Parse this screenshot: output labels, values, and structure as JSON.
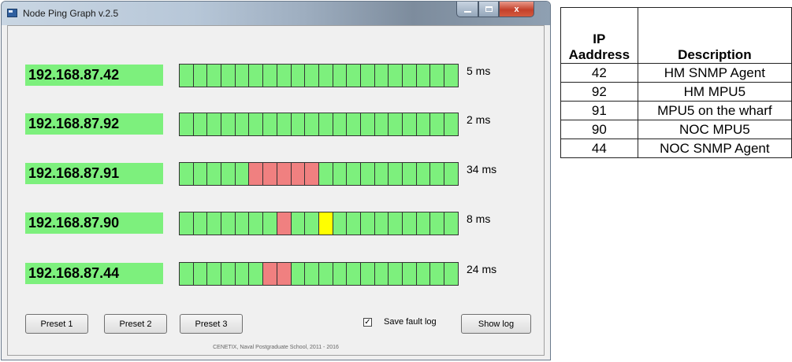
{
  "window": {
    "title": "Node Ping Graph  v.2.5",
    "controls": {
      "close_label": "x"
    }
  },
  "nodes": [
    {
      "ip": "192.168.87.42",
      "latency": "5 ms",
      "cells": [
        "ok",
        "ok",
        "ok",
        "ok",
        "ok",
        "ok",
        "ok",
        "ok",
        "ok",
        "ok",
        "ok",
        "ok",
        "ok",
        "ok",
        "ok",
        "ok",
        "ok",
        "ok",
        "ok",
        "ok"
      ]
    },
    {
      "ip": "192.168.87.92",
      "latency": "2 ms",
      "cells": [
        "ok",
        "ok",
        "ok",
        "ok",
        "ok",
        "ok",
        "ok",
        "ok",
        "ok",
        "ok",
        "ok",
        "ok",
        "ok",
        "ok",
        "ok",
        "ok",
        "ok",
        "ok",
        "ok",
        "ok"
      ]
    },
    {
      "ip": "192.168.87.91",
      "latency": "34 ms",
      "cells": [
        "ok",
        "ok",
        "ok",
        "ok",
        "ok",
        "bad",
        "bad",
        "bad",
        "bad",
        "bad",
        "ok",
        "ok",
        "ok",
        "ok",
        "ok",
        "ok",
        "ok",
        "ok",
        "ok",
        "ok"
      ]
    },
    {
      "ip": "192.168.87.90",
      "latency": "8 ms",
      "cells": [
        "ok",
        "ok",
        "ok",
        "ok",
        "ok",
        "ok",
        "ok",
        "bad",
        "ok",
        "ok",
        "warn",
        "ok",
        "ok",
        "ok",
        "ok",
        "ok",
        "ok",
        "ok",
        "ok",
        "ok"
      ]
    },
    {
      "ip": "192.168.87.44",
      "latency": "24 ms",
      "cells": [
        "ok",
        "ok",
        "ok",
        "ok",
        "ok",
        "ok",
        "bad",
        "bad",
        "ok",
        "ok",
        "ok",
        "ok",
        "ok",
        "ok",
        "ok",
        "ok",
        "ok",
        "ok",
        "ok",
        "ok"
      ]
    }
  ],
  "buttons": {
    "preset1": "Preset 1",
    "preset2": "Preset 2",
    "preset3": "Preset 3",
    "show_log": "Show log"
  },
  "save_fault_log": {
    "label": "Save fault log",
    "checked": true,
    "mark": "✓"
  },
  "footer": "CENETIX, Naval Postgraduate School, 2011 - 2016",
  "table": {
    "headers": {
      "ip": "IP\nAaddress",
      "description": "Description"
    },
    "rows": [
      {
        "ip": "42",
        "description": "HM SNMP Agent"
      },
      {
        "ip": "92",
        "description": "HM MPU5"
      },
      {
        "ip": "91",
        "description": "MPU5 on the wharf"
      },
      {
        "ip": "90",
        "description": "NOC MPU5"
      },
      {
        "ip": "44",
        "description": "NOC SNMP Agent"
      }
    ]
  },
  "colors": {
    "ok": "#7df07d",
    "bad": "#f08080",
    "warn": "#ffff00",
    "ip_label_bg": "#7df07d"
  }
}
